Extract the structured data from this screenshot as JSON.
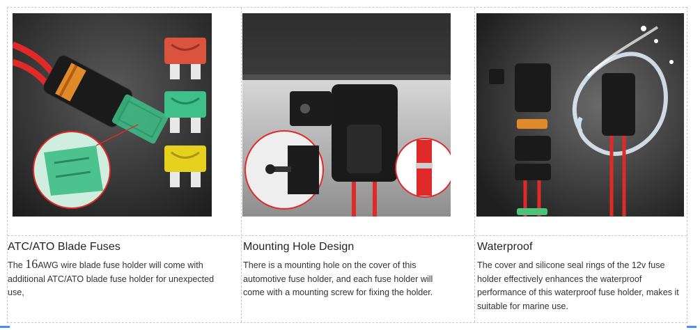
{
  "cards": [
    {
      "title": "ATC/ATO Blade Fuses",
      "desc_pre": "The ",
      "desc_num": "16",
      "desc_post": "AWG wire blade fuse holder will come with additional ATC/ATO blade fuse holder for unexpected use,"
    },
    {
      "title": "Mounting Hole Design",
      "desc": "There is a mounting hole on the cover of this automotive fuse holder, and each fuse holder will come with a mounting screw for fixing the holder."
    },
    {
      "title": "Waterproof",
      "desc": "The cover and silicone seal rings of the 12v fuse holder effectively enhances the waterproof performance of this waterproof fuse holder, makes it suitable for marine use."
    }
  ],
  "colors": {
    "fuse_red": "#d9533f",
    "fuse_green": "#3fbf8a",
    "fuse_yellow": "#e6d21e",
    "wire_red": "#e02a2a",
    "seal_orange": "#e08a2a",
    "seal_green": "#4cc27a"
  }
}
